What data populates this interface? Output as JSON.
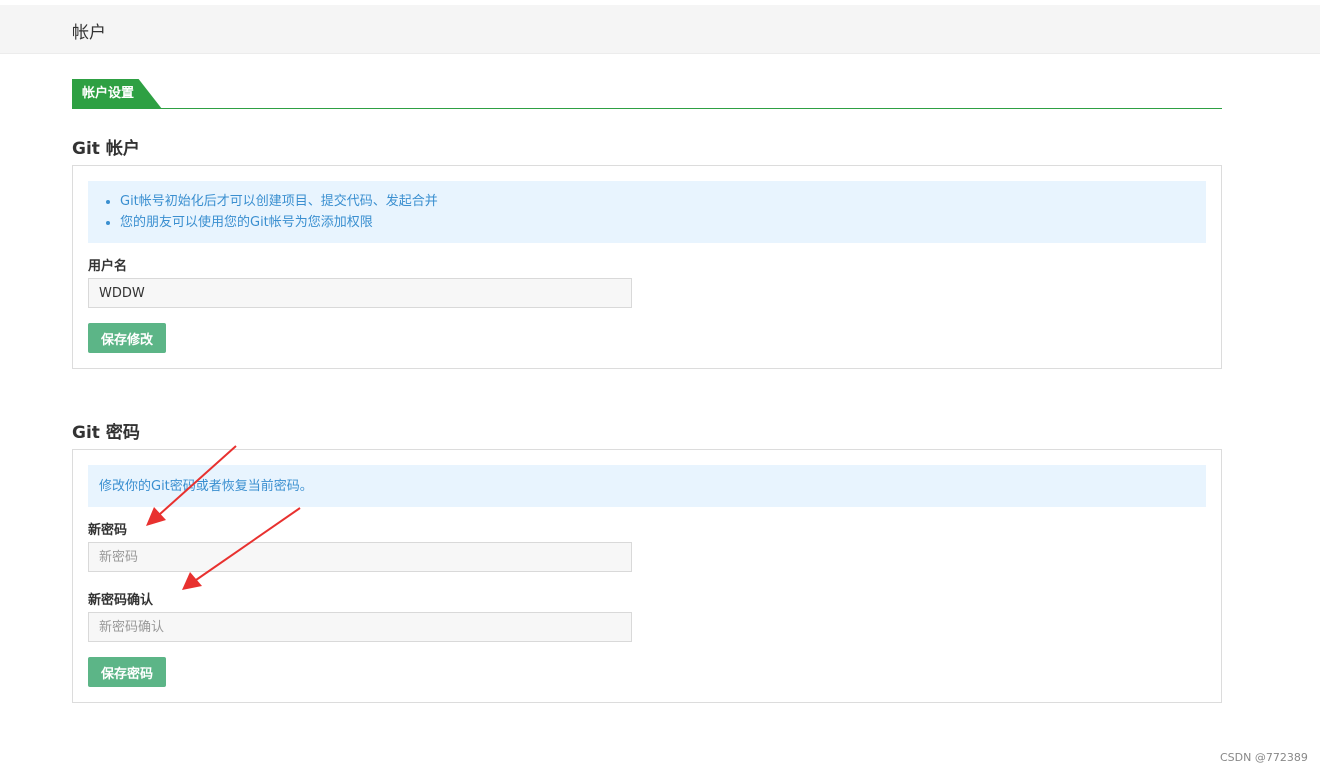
{
  "header": {
    "title": "帐户"
  },
  "tabs": [
    {
      "label": "帐户设置"
    }
  ],
  "git_account": {
    "title": "Git 帐户",
    "info": [
      "Git帐号初始化后才可以创建项目、提交代码、发起合并",
      "您的朋友可以使用您的Git帐号为您添加权限"
    ],
    "username_label": "用户名",
    "username_value": "WDDW",
    "save_label": "保存修改"
  },
  "git_password": {
    "title": "Git 密码",
    "info": "修改你的Git密码或者恢复当前密码。",
    "new_password_label": "新密码",
    "new_password_placeholder": "新密码",
    "confirm_label": "新密码确认",
    "confirm_placeholder": "新密码确认",
    "save_label": "保存密码"
  },
  "watermark": "CSDN @772389",
  "colors": {
    "accent": "#2ea043",
    "button": "#5cb587",
    "info_bg": "#e8f4fe",
    "info_text": "#3a8fd0",
    "annotation_arrow": "#e8312f"
  }
}
